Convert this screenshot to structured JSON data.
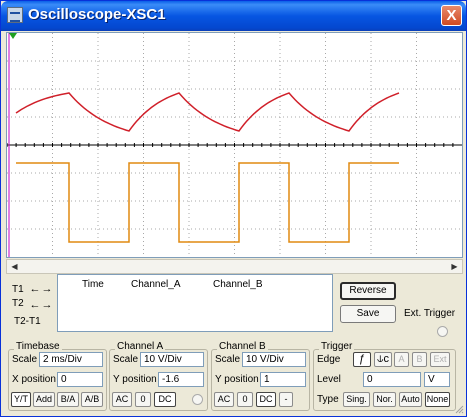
{
  "window": {
    "title": "Oscilloscope-XSC1",
    "close_glyph": "X"
  },
  "colors": {
    "trace_a": "#d0202a",
    "trace_b": "#e08a10",
    "t1_cursor": "#c000c0",
    "grid": "#a8a8a8",
    "axis": "#000000"
  },
  "cursors": {
    "t1_label": "T1",
    "t2_label": "T2",
    "diff_label": "T2-T1",
    "left_arrow": "←",
    "right_arrow": "→"
  },
  "readout": {
    "col_time": "Time",
    "col_a": "Channel_A",
    "col_b": "Channel_B"
  },
  "buttons": {
    "reverse": "Reverse",
    "save": "Save",
    "ext_trigger": "Ext. Trigger"
  },
  "timebase": {
    "title": "Timebase",
    "scale_label": "Scale",
    "scale_value": "2 ms/Div",
    "xpos_label": "X position",
    "xpos_value": "0",
    "modes": [
      "Y/T",
      "Add",
      "B/A",
      "A/B"
    ]
  },
  "channel_a": {
    "title": "Channel A",
    "scale_label": "Scale",
    "scale_value": "10  V/Div",
    "ypos_label": "Y position",
    "ypos_value": "-1.6",
    "coupling": [
      "AC",
      "0",
      "DC"
    ]
  },
  "channel_b": {
    "title": "Channel B",
    "scale_label": "Scale",
    "scale_value": "10  V/Div",
    "ypos_label": "Y position",
    "ypos_value": "1",
    "coupling": [
      "AC",
      "0",
      "DC",
      "-"
    ]
  },
  "trigger": {
    "title": "Trigger",
    "edge_label": "Edge",
    "edge_rise": "ƒ",
    "edge_fall": "⫝c",
    "sources": [
      "A",
      "B",
      "Ext"
    ],
    "level_label": "Level",
    "level_value": "0",
    "level_unit": "V",
    "type_label": "Type",
    "types": [
      "Sing.",
      "Nor.",
      "Auto",
      "None"
    ]
  }
}
